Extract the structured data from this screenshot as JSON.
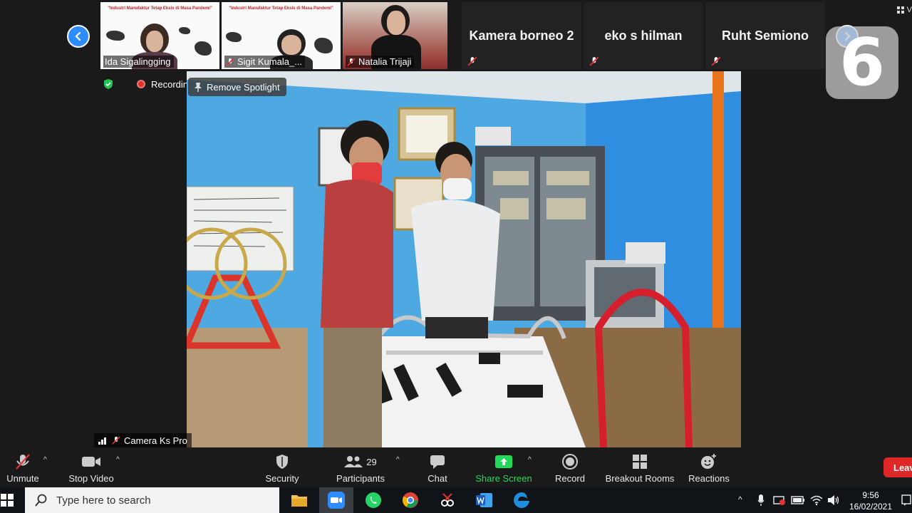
{
  "gallery": {
    "tiles": [
      {
        "name": "Ida Sigalingging",
        "slide_title": "\"Industri Manufaktur Tetap Eksis di Masa Pandemi\""
      },
      {
        "name": "Sigit Kumala_...",
        "slide_title": "\"Industri Manufaktur Tetap Eksis di Masa Pandemi\""
      },
      {
        "name": "Natalia Trijaji"
      },
      {
        "name": "Kamera borneo 2"
      },
      {
        "name": "eko s hilman"
      },
      {
        "name": "Ruht Semiono"
      }
    ],
    "top_corner": "V"
  },
  "status": {
    "recording": "Recording",
    "remove_spotlight": "Remove Spotlight"
  },
  "video": {
    "participant_name": "Camera Ks Pro"
  },
  "watermark": "6",
  "controls": {
    "unmute": "Unmute",
    "stop_video": "Stop Video",
    "security": "Security",
    "participants": "Participants",
    "participants_count": "29",
    "chat": "Chat",
    "share_screen": "Share Screen",
    "record": "Record",
    "breakout_rooms": "Breakout Rooms",
    "reactions": "Reactions",
    "leave": "Leave"
  },
  "taskbar": {
    "search_placeholder": "Type here to search",
    "time": "9:56",
    "date": "16/02/2021"
  },
  "colors": {
    "accent": "#2d8cff",
    "share_green": "#23d959",
    "leave_red": "#e02828",
    "record_red": "#e0332f"
  }
}
